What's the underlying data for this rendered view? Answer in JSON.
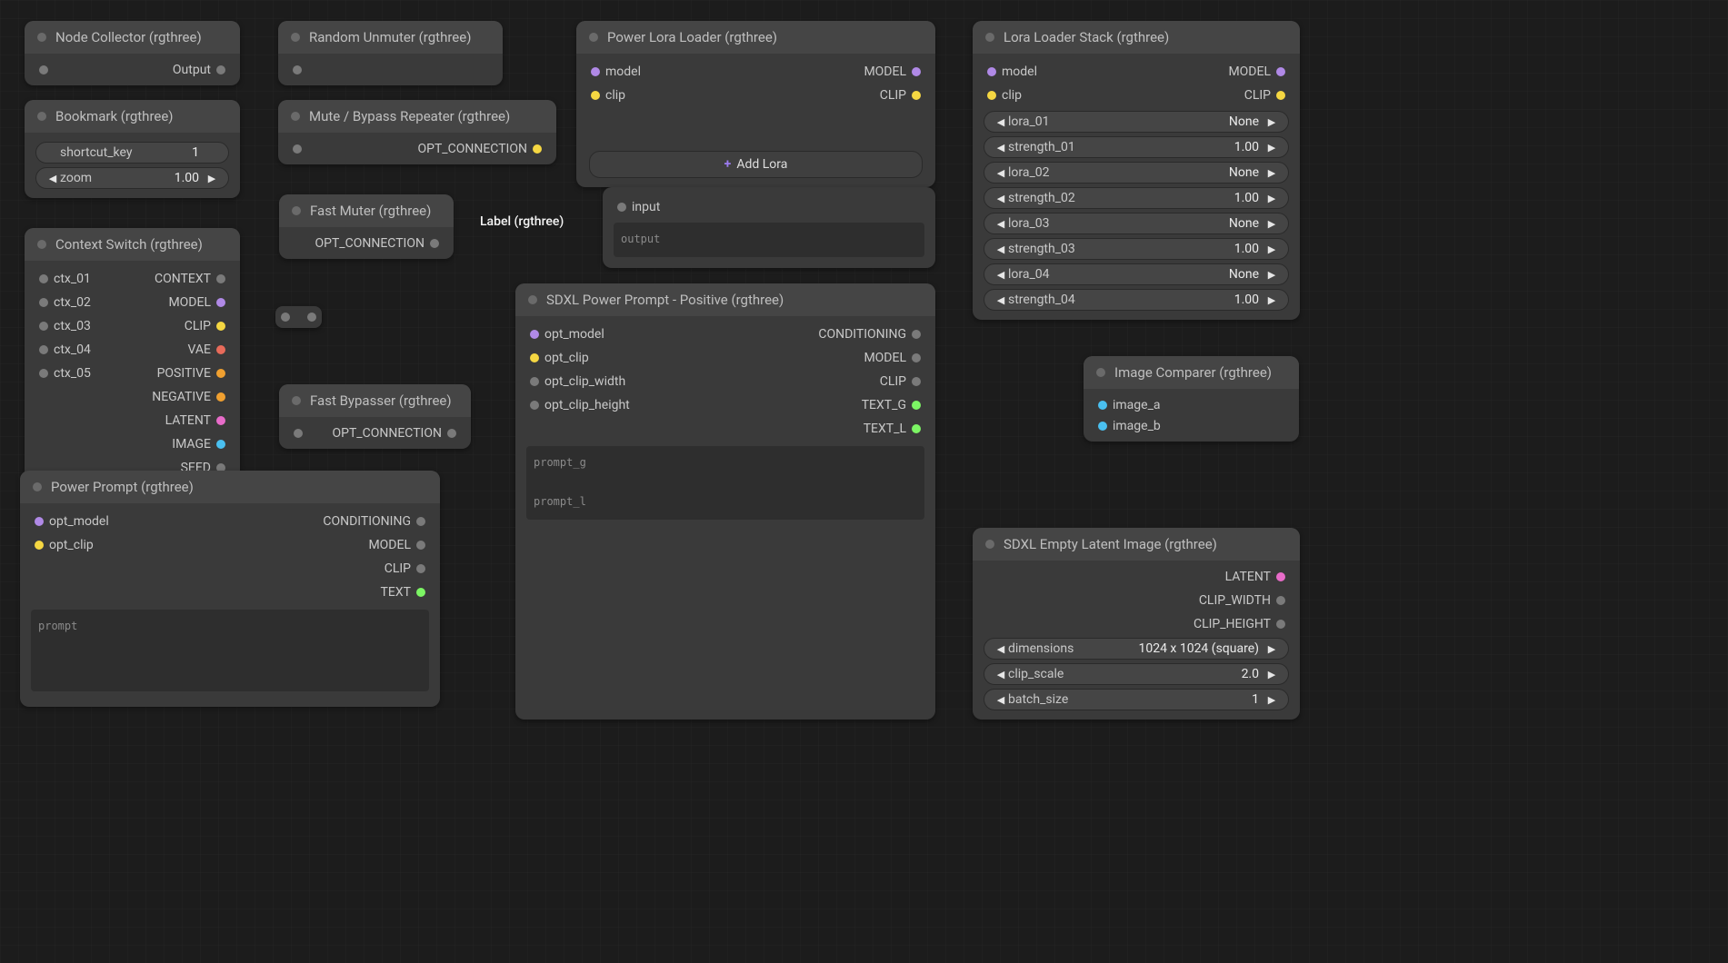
{
  "free_label": "Label (rgthree)",
  "nodes": {
    "node_collector": {
      "title": "Node Collector (rgthree)",
      "outputs": [
        "Output"
      ]
    },
    "random_unmuter": {
      "title": "Random Unmuter (rgthree)"
    },
    "power_lora_loader": {
      "title": "Power Lora Loader (rgthree)",
      "in": {
        "model": "model",
        "clip": "clip"
      },
      "out": {
        "model": "MODEL",
        "clip": "CLIP"
      },
      "btn": "Add Lora"
    },
    "lora_loader_stack": {
      "title": "Lora Loader Stack (rgthree)",
      "in": {
        "model": "model",
        "clip": "clip"
      },
      "out": {
        "model": "MODEL",
        "clip": "CLIP"
      },
      "widgets": [
        {
          "name": "lora_01",
          "value": "None"
        },
        {
          "name": "strength_01",
          "value": "1.00"
        },
        {
          "name": "lora_02",
          "value": "None"
        },
        {
          "name": "strength_02",
          "value": "1.00"
        },
        {
          "name": "lora_03",
          "value": "None"
        },
        {
          "name": "strength_03",
          "value": "1.00"
        },
        {
          "name": "lora_04",
          "value": "None"
        },
        {
          "name": "strength_04",
          "value": "1.00"
        }
      ]
    },
    "bookmark": {
      "title": "Bookmark (rgthree)",
      "widgets": [
        {
          "name": "shortcut_key",
          "value": "1",
          "arrows": false
        },
        {
          "name": "zoom",
          "value": "1.00",
          "arrows": true
        }
      ]
    },
    "mute_bypass_repeater": {
      "title": "Mute / Bypass Repeater (rgthree)",
      "out": "OPT_CONNECTION"
    },
    "fast_muter": {
      "title": "Fast Muter (rgthree)",
      "out": "OPT_CONNECTION"
    },
    "fast_bypasser": {
      "title": "Fast Bypasser (rgthree)",
      "out": "OPT_CONNECTION"
    },
    "any_input": {
      "in": "input",
      "out_placeholder": "output"
    },
    "context_switch": {
      "title": "Context Switch (rgthree)",
      "ins": [
        "ctx_01",
        "ctx_02",
        "ctx_03",
        "ctx_04",
        "ctx_05"
      ],
      "outs": [
        {
          "label": "CONTEXT",
          "c": "c-gray"
        },
        {
          "label": "MODEL",
          "c": "c-purple"
        },
        {
          "label": "CLIP",
          "c": "c-yellow"
        },
        {
          "label": "VAE",
          "c": "c-red"
        },
        {
          "label": "POSITIVE",
          "c": "c-orange"
        },
        {
          "label": "NEGATIVE",
          "c": "c-orange"
        },
        {
          "label": "LATENT",
          "c": "c-pink"
        },
        {
          "label": "IMAGE",
          "c": "c-cyan"
        },
        {
          "label": "SEED",
          "c": "c-gray"
        }
      ]
    },
    "sdxl_power_prompt": {
      "title": "SDXL Power Prompt - Positive (rgthree)",
      "ins": [
        "opt_model",
        "opt_clip",
        "opt_clip_width",
        "opt_clip_height"
      ],
      "outs": [
        {
          "label": "CONDITIONING",
          "c": "c-gray"
        },
        {
          "label": "MODEL",
          "c": "c-gray"
        },
        {
          "label": "CLIP",
          "c": "c-gray"
        },
        {
          "label": "TEXT_G",
          "c": "c-lime"
        },
        {
          "label": "TEXT_L",
          "c": "c-lime"
        }
      ],
      "text": "prompt_g\n\nprompt_l"
    },
    "power_prompt": {
      "title": "Power Prompt (rgthree)",
      "ins": [
        {
          "label": "opt_model",
          "c": "c-purple"
        },
        {
          "label": "opt_clip",
          "c": "c-yellow"
        }
      ],
      "outs": [
        {
          "label": "CONDITIONING",
          "c": "c-gray"
        },
        {
          "label": "MODEL",
          "c": "c-gray"
        },
        {
          "label": "CLIP",
          "c": "c-gray"
        },
        {
          "label": "TEXT",
          "c": "c-lime"
        }
      ],
      "text": "prompt"
    },
    "image_comparer": {
      "title": "Image Comparer (rgthree)",
      "ins": [
        "image_a",
        "image_b"
      ]
    },
    "sdxl_empty_latent": {
      "title": "SDXL Empty Latent Image (rgthree)",
      "outs": [
        {
          "label": "LATENT",
          "c": "c-pink"
        },
        {
          "label": "CLIP_WIDTH",
          "c": "c-gray"
        },
        {
          "label": "CLIP_HEIGHT",
          "c": "c-gray"
        }
      ],
      "widgets": [
        {
          "name": "dimensions",
          "value": "1024 x 1024  (square)"
        },
        {
          "name": "clip_scale",
          "value": "2.0"
        },
        {
          "name": "batch_size",
          "value": "1"
        }
      ]
    }
  }
}
